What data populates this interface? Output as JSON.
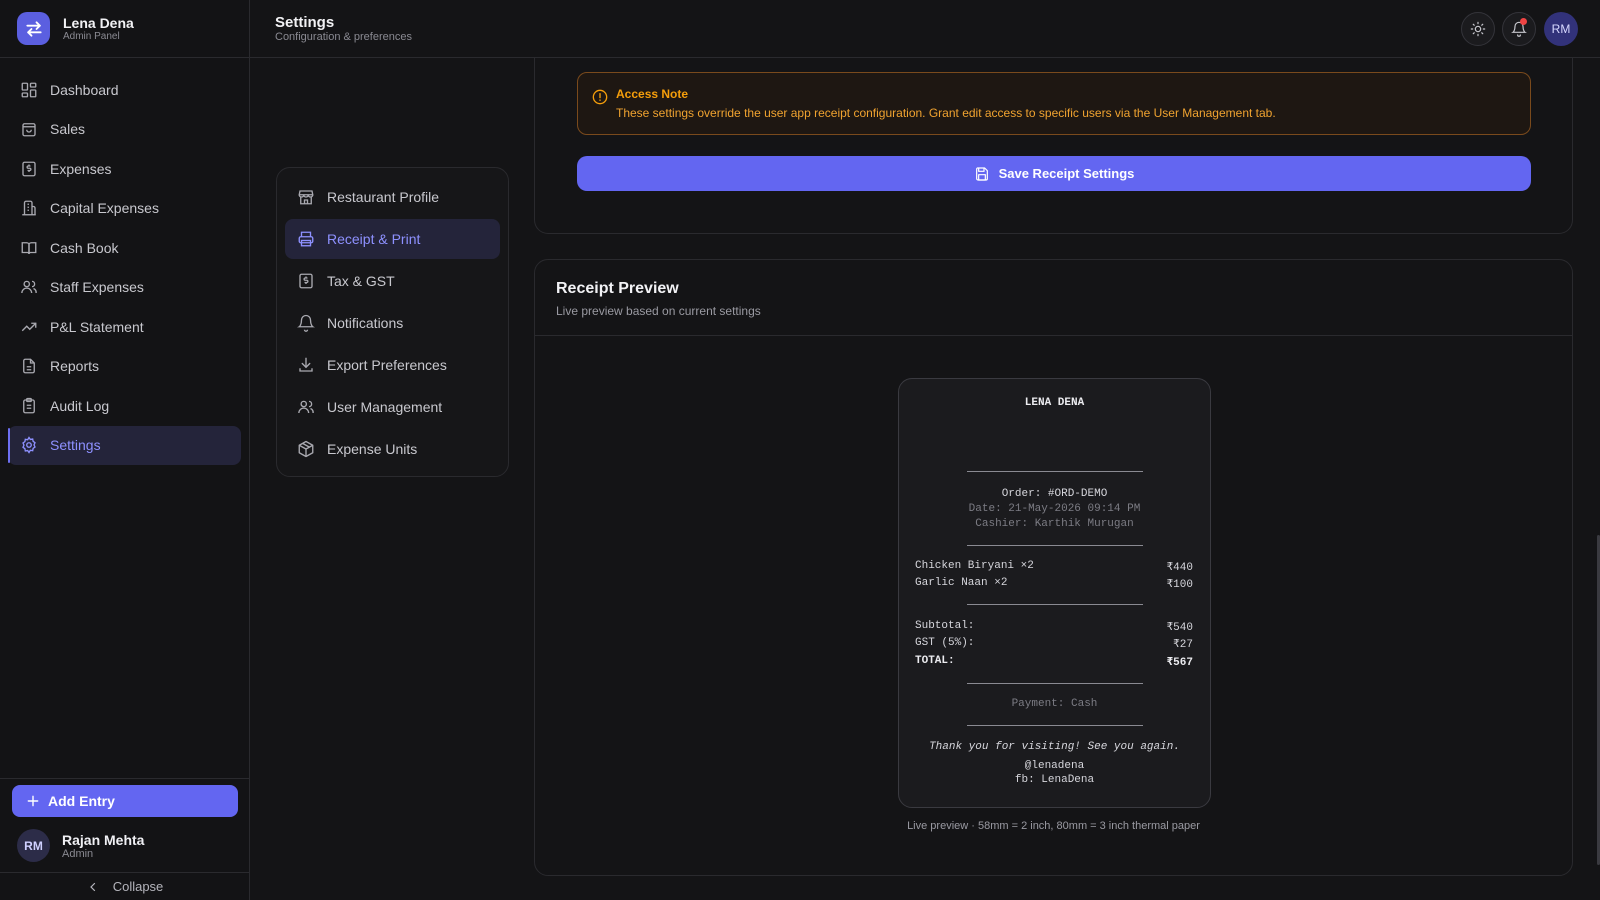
{
  "brand": {
    "name": "Lena Dena",
    "subtitle": "Admin Panel"
  },
  "sidebar": {
    "items": [
      {
        "label": "Dashboard",
        "icon": "dashboard-icon"
      },
      {
        "label": "Sales",
        "icon": "shopping-bag-icon"
      },
      {
        "label": "Expenses",
        "icon": "receipt-icon"
      },
      {
        "label": "Capital Expenses",
        "icon": "building-icon"
      },
      {
        "label": "Cash Book",
        "icon": "book-icon"
      },
      {
        "label": "Staff Expenses",
        "icon": "users-icon"
      },
      {
        "label": "P&L Statement",
        "icon": "trending-up-icon"
      },
      {
        "label": "Reports",
        "icon": "file-text-icon"
      },
      {
        "label": "Audit Log",
        "icon": "clipboard-icon"
      },
      {
        "label": "Settings",
        "icon": "gear-icon",
        "active": true
      }
    ],
    "add_entry": "Add Entry",
    "user": {
      "initials": "RM",
      "name": "Rajan Mehta",
      "role": "Admin"
    },
    "collapse": "Collapse"
  },
  "header": {
    "title": "Settings",
    "subtitle": "Configuration & preferences",
    "avatar": "RM"
  },
  "settings_menu": {
    "items": [
      {
        "label": "Restaurant Profile",
        "icon": "store-icon"
      },
      {
        "label": "Receipt & Print",
        "icon": "printer-icon",
        "active": true
      },
      {
        "label": "Tax & GST",
        "icon": "tax-receipt-icon"
      },
      {
        "label": "Notifications",
        "icon": "bell-icon"
      },
      {
        "label": "Export Preferences",
        "icon": "download-icon"
      },
      {
        "label": "User Management",
        "icon": "users-icon"
      },
      {
        "label": "Expense Units",
        "icon": "package-icon"
      }
    ]
  },
  "access_note": {
    "title": "Access Note",
    "text": "These settings override the user app receipt configuration. Grant edit access to specific users via the User Management tab."
  },
  "save_button": "Save Receipt Settings",
  "preview": {
    "title": "Receipt Preview",
    "subtitle": "Live preview based on current settings",
    "footer": "Live preview · 58mm = 2 inch, 80mm = 3 inch thermal paper"
  },
  "receipt": {
    "shop_name": "LENA DENA",
    "order": "Order: #ORD-DEMO",
    "date": "Date: 21-May-2026  09:14 PM",
    "cashier": "Cashier: Karthik Murugan",
    "items": [
      {
        "name": "Chicken Biryani ×2",
        "amount": "₹440"
      },
      {
        "name": "Garlic Naan ×2",
        "amount": "₹100"
      }
    ],
    "subtotal_label": "Subtotal:",
    "subtotal": "₹540",
    "gst_label": "GST (5%):",
    "gst": "₹27",
    "total_label": "TOTAL:",
    "total": "₹567",
    "payment": "Payment: Cash",
    "thanks": "Thank you for visiting! See you again.",
    "instagram": "@lenadena",
    "facebook": "fb: LenaDena"
  },
  "colors": {
    "accent": "#6366f1",
    "warning": "#f59e0b",
    "background": "#141416"
  }
}
